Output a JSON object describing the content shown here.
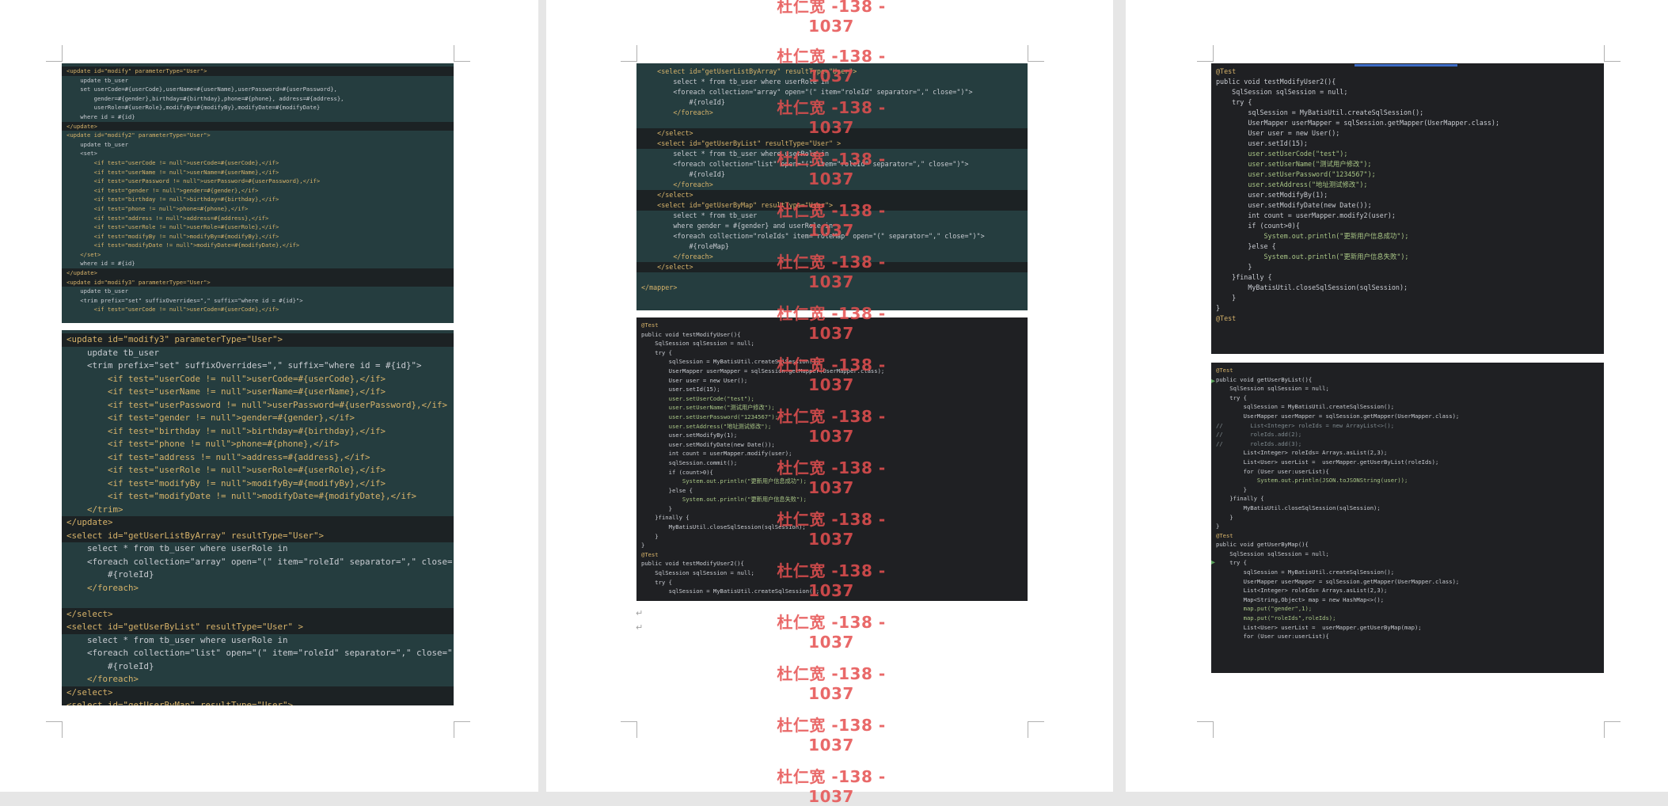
{
  "watermark": {
    "text": "杜仁宽 -138 - 1037",
    "color": "#e65050",
    "count": 16
  },
  "shot_a": [
    "<update id=\"modify\" parameterType=\"User\">",
    "    update tb_user",
    "    set userCode=#{userCode},userName=#{userName},userPassword=#{userPassword},",
    "        gender=#{gender},birthday=#{birthday},phone=#{phone}, address=#{address},",
    "        userRole=#{userRole},modifyBy=#{modifyBy},modifyDate=#{modifyDate}",
    "    where id = #{id}",
    "</update>",
    "<update id=\"modify2\" parameterType=\"User\">",
    "    update tb_user",
    "    <set>",
    "        <if test=\"userCode != null\">userCode=#{userCode},</if>",
    "        <if test=\"userName != null\">userName=#{userName},</if>",
    "        <if test=\"userPassword != null\">userPassword=#{userPassword},</if>",
    "        <if test=\"gender != null\">gender=#{gender},</if>",
    "        <if test=\"birthday != null\">birthday=#{birthday},</if>",
    "        <if test=\"phone != null\">phone=#{phone},</if>",
    "        <if test=\"address != null\">address=#{address},</if>",
    "        <if test=\"userRole != null\">userRole=#{userRole},</if>",
    "        <if test=\"modifyBy != null\">modifyBy=#{modifyBy},</if>",
    "        <if test=\"modifyDate != null\">modifyDate=#{modifyDate},</if>",
    "    </set>",
    "    where id = #{id}",
    "</update>",
    "<update id=\"modify3\" parameterType=\"User\">",
    "    update tb_user",
    "    <trim prefix=\"set\" suffixOverrides=\",\" suffix=\"where id = #{id}\">",
    "        <if test=\"userCode != null\">userCode=#{userCode},</if>"
  ],
  "shot_b": [
    "<update id=\"modify3\" parameterType=\"User\">",
    "    update tb_user",
    "    <trim prefix=\"set\" suffixOverrides=\",\" suffix=\"where id = #{id}\">",
    "        <if test=\"userCode != null\">userCode=#{userCode},</if>",
    "        <if test=\"userName != null\">userName=#{userName},</if>",
    "        <if test=\"userPassword != null\">userPassword=#{userPassword},</if>",
    "        <if test=\"gender != null\">gender=#{gender},</if>",
    "        <if test=\"birthday != null\">birthday=#{birthday},</if>",
    "        <if test=\"phone != null\">phone=#{phone},</if>",
    "        <if test=\"address != null\">address=#{address},</if>",
    "        <if test=\"userRole != null\">userRole=#{userRole},</if>",
    "        <if test=\"modifyBy != null\">modifyBy=#{modifyBy},</if>",
    "        <if test=\"modifyDate != null\">modifyDate=#{modifyDate},</if>",
    "    </trim>",
    "</update>",
    "<select id=\"getUserListByArray\" resultType=\"User\">",
    "    select * from tb_user where userRole in",
    "    <foreach collection=\"array\" open=\"(\" item=\"roleId\" separator=\",\" close=\")\">",
    "        #{roleId}",
    "    </foreach>",
    "",
    "</select>",
    "<select id=\"getUserByList\" resultType=\"User\" >",
    "    select * from tb_user where userRole in",
    "    <foreach collection=\"list\" open=\"(\" item=\"roleId\" separator=\",\" close=\")\">",
    "        #{roleId}",
    "    </foreach>",
    "</select>",
    "<select id=\"getUserByMap\" resultType=\"User\">"
  ],
  "shot_c": [
    "    <select id=\"getUserListByArray\" resultType=\"User\">",
    "        select * from tb_user where userRole in",
    "        <foreach collection=\"array\" open=\"(\" item=\"roleId\" separator=\",\" close=\")\">",
    "            #{roleId}",
    "        </foreach>",
    "",
    "    </select>",
    "    <select id=\"getUserByList\" resultType=\"User\" >",
    "        select * from tb_user where userRole in",
    "        <foreach collection=\"list\" open=\"(\" item=\"roleId\" separator=\",\" close=\")\">",
    "            #{roleId}",
    "        </foreach>",
    "    </select>",
    "    <select id=\"getUserByMap\" resultType=\"User\">",
    "        select * from tb_user",
    "        where gender = #{gender} and userRole in",
    "        <foreach collection=\"roleIds\" item=\"roleMap\" open=\"(\" separator=\",\" close=\")\">",
    "            #{roleMap}",
    "        </foreach>",
    "    </select>",
    "",
    "</mapper>"
  ],
  "shot_d": [
    "@Test",
    "public void testModifyUser(){",
    "    SqlSession sqlSession = null;",
    "    try {",
    "        sqlSession = MyBatisUtil.createSqlSession();",
    "        UserMapper userMapper = sqlSession.getMapper(UserMapper.class);",
    "        User user = new User();",
    "        user.setId(15);",
    "        user.setUserCode(\"test\");",
    "        user.setUserName(\"测试用户修改\");",
    "        user.setUserPassword(\"1234567\");",
    "        user.setAddress(\"地址测试修改\");",
    "        user.setModifyBy(1);",
    "        user.setModifyDate(new Date());",
    "        int count = userMapper.modify(user);",
    "        sqlSession.commit();",
    "        if (count>0){",
    "            System.out.println(\"更新用户信息成功\");",
    "        }else {",
    "            System.out.println(\"更新用户信息失败\");",
    "        }",
    "    }finally {",
    "        MyBatisUtil.closeSqlSession(sqlSession);",
    "    }",
    "}",
    "@Test",
    "public void testModifyUser2(){",
    "    SqlSession sqlSession = null;",
    "    try {",
    "        sqlSession = MyBatisUtil.createSqlSession();"
  ],
  "shot_e": [
    "@Test",
    "public void testModifyUser2(){",
    "    SqlSession sqlSession = null;",
    "    try {",
    "        sqlSession = MyBatisUtil.createSqlSession();",
    "        UserMapper userMapper = sqlSession.getMapper(UserMapper.class);",
    "        User user = new User();",
    "        user.setId(15);",
    "        user.setUserCode(\"test\");",
    "        user.setUserName(\"测试用户修改\");",
    "        user.setUserPassword(\"1234567\");",
    "        user.setAddress(\"地址测试修改\");",
    "        user.setModifyBy(1);",
    "        user.setModifyDate(new Date());",
    "        int count = userMapper.modify2(user);",
    "        if (count>0){",
    "            System.out.println(\"更新用户信息成功\");",
    "        }else {",
    "            System.out.println(\"更新用户信息失败\");",
    "        }",
    "    }finally {",
    "        MyBatisUtil.closeSqlSession(sqlSession);",
    "    }",
    "}",
    "@Test"
  ],
  "shot_f": [
    "@Test",
    "public void getUserByList(){",
    "    SqlSession sqlSession = null;",
    "    try {",
    "        sqlSession = MyBatisUtil.createSqlSession();",
    "        UserMapper userMapper = sqlSession.getMapper(UserMapper.class);",
    "//        List<Integer> roleIds = new ArrayList<>();",
    "//        roleIds.add(2);",
    "//        roleIds.add(3);",
    "        List<Integer> roleIds= Arrays.asList(2,3);",
    "        List<User> userList =  userMapper.getUserByList(roleIds);",
    "        for (User user:userList){",
    "            System.out.println(JSON.toJSONString(user));",
    "        }",
    "    }finally {",
    "        MyBatisUtil.closeSqlSession(sqlSession);",
    "    }",
    "}",
    "@Test",
    "public void getUserByMap(){",
    "    SqlSession sqlSession = null;",
    "    try {",
    "        sqlSession = MyBatisUtil.createSqlSession();",
    "        UserMapper userMapper = sqlSession.getMapper(UserMapper.class);",
    "        List<Integer> roleIds= Arrays.asList(2,3);",
    "        Map<String,Object> map = new HashMap<>();",
    "        map.put(\"gender\",1);",
    "        map.put(\"roleIds\",roleIds);",
    "        List<User> userList =  userMapper.getUserByMap(map);",
    "        for (User user:userList){"
  ]
}
